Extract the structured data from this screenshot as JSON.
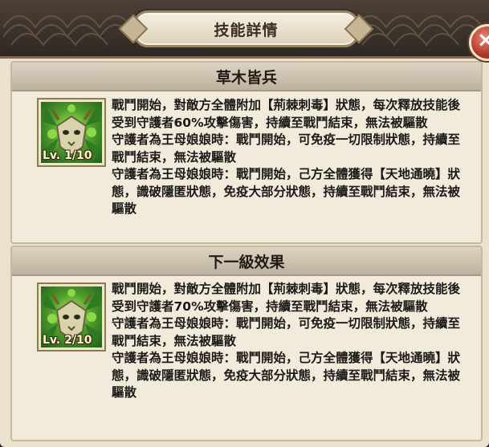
{
  "dialog": {
    "title": "技能詳情"
  },
  "current": {
    "title": "草木皆兵",
    "level_label": "Lv. 1/10",
    "lines": [
      "戰鬥開始，對敵方全體附加【荊棘刺毒】狀態，每次釋放技能後受到守護者60%攻擊傷害，持續至戰鬥結束，無法被驅散",
      "守護者為王母娘娘時：戰鬥開始，可免疫一切限制狀態，持續至戰鬥結束，無法被驅散",
      "守護者為王母娘娘時：戰鬥開始，己方全體獲得【天地通曉】狀態，識破隱匿狀態，免疫大部分狀態，持續至戰鬥結束，無法被驅散"
    ]
  },
  "next": {
    "title": "下一級效果",
    "level_label": "Lv. 2/10",
    "lines": [
      "戰鬥開始，對敵方全體附加【荊棘刺毒】狀態，每次釋放技能後受到守護者70%攻擊傷害，持續至戰鬥結束，無法被驅散",
      "守護者為王母娘娘時：戰鬥開始，可免疫一切限制狀態，持續至戰鬥結束，無法被驅散",
      "守護者為王母娘娘時：戰鬥開始，己方全體獲得【天地通曉】狀態，識破隱匿狀態，免疫大部分狀態，持續至戰鬥結束，無法被驅散"
    ]
  },
  "icons": {
    "close": "close-icon",
    "skill": "forest-mask-skill-icon"
  },
  "colors": {
    "panel_bg": "#ebe2cd",
    "header_bg": "#2f2823",
    "close_red": "#b13526"
  }
}
